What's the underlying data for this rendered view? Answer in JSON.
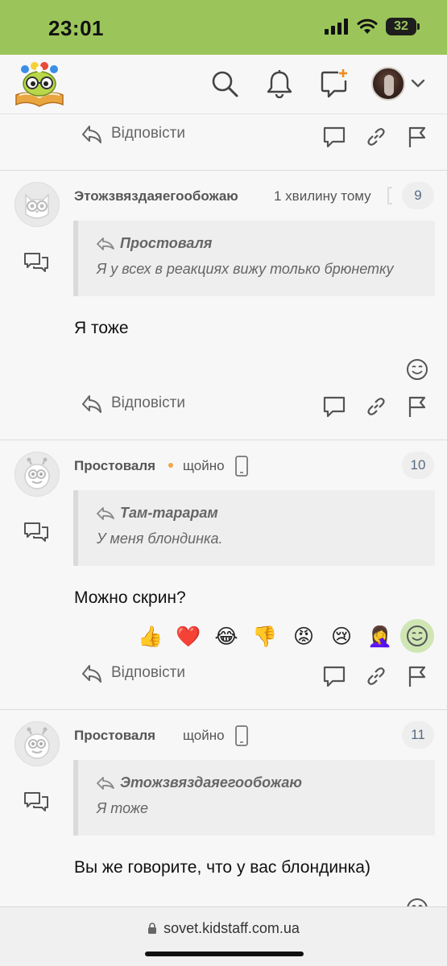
{
  "status_bar": {
    "time": "23:01",
    "battery": "32"
  },
  "header": {
    "icons": [
      "search-icon",
      "bell-icon",
      "new-message-icon",
      "user-avatar",
      "chevron-down-icon"
    ]
  },
  "top_actions": {
    "reply_label": "Відповісти"
  },
  "posts": [
    {
      "number": "9",
      "author": "Этожзвяздаяегообожаю",
      "time": "1 хвилину тому",
      "quote_author": "Простоваля",
      "quote_text": "Я у всех в реакциях вижу только брюнетку",
      "body": "Я тоже",
      "reply_label": "Відповісти"
    },
    {
      "number": "10",
      "author": "Простоваля",
      "time": "щойно",
      "quote_author": "Там-тарарам",
      "quote_text": "У меня блондинка.",
      "body": "Можно скрин?",
      "reply_label": "Відповісти",
      "reactions": [
        "👍",
        "❤️",
        "😂",
        "👎",
        "😡",
        "😢",
        "🤦‍♀️"
      ]
    },
    {
      "number": "11",
      "author": "Простоваля",
      "time": "щойно",
      "quote_author": "Этожзвяздаяегообожаю",
      "quote_text": "Я тоже",
      "body": "Вы же говорите, что у вас блондинка)"
    }
  ],
  "browser": {
    "url": "sovet.kidstaff.com.ua"
  },
  "colors": {
    "status_bar": "#9bc55a",
    "accent_orange": "#f3a54a",
    "reaction_highlight": "#cfe6b4"
  }
}
